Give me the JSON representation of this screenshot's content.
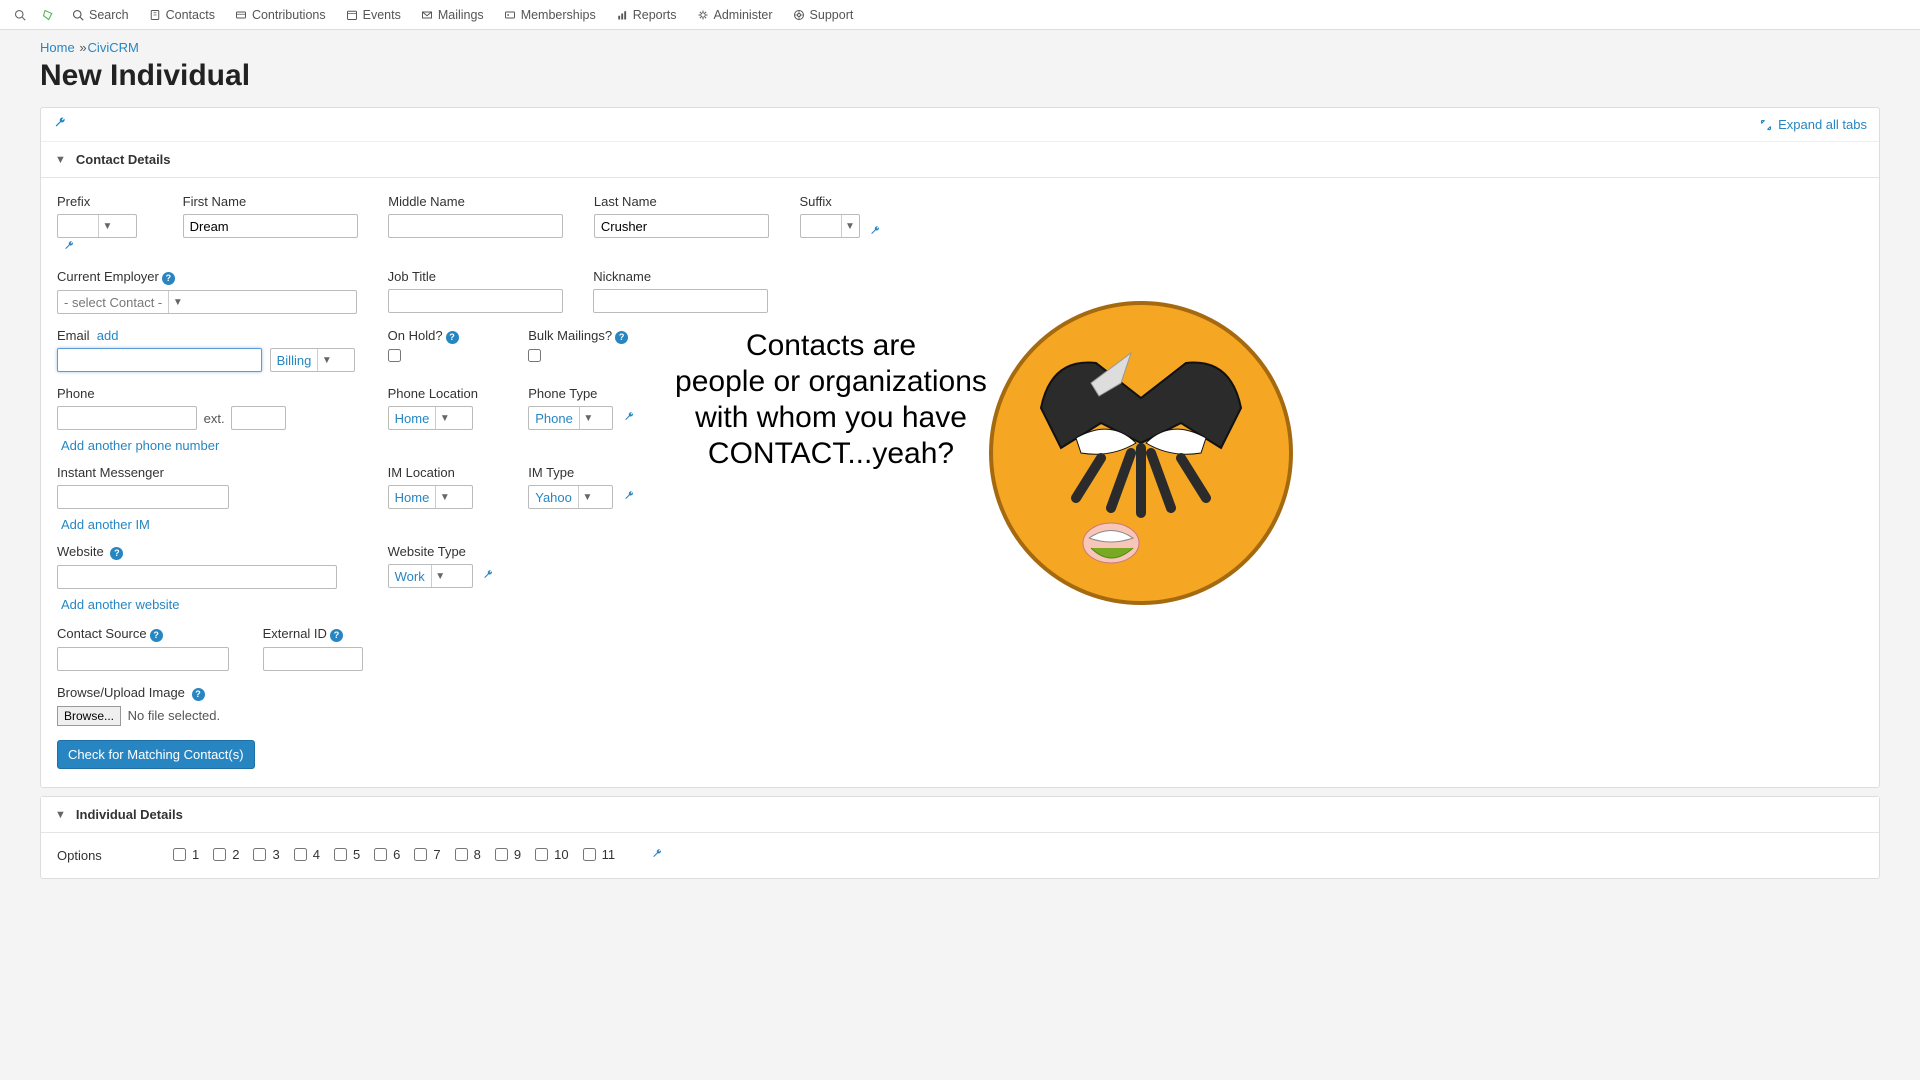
{
  "nav": {
    "search": "Search",
    "contacts": "Contacts",
    "contributions": "Contributions",
    "events": "Events",
    "mailings": "Mailings",
    "memberships": "Memberships",
    "reports": "Reports",
    "administer": "Administer",
    "support": "Support"
  },
  "breadcrumb": {
    "home": "Home",
    "civicrm": "CiviCRM"
  },
  "page_title": "New Individual",
  "expand_all": "Expand all tabs",
  "sections": {
    "contact_details": "Contact Details",
    "individual_details": "Individual Details"
  },
  "labels": {
    "prefix": "Prefix",
    "first_name": "First Name",
    "middle_name": "Middle Name",
    "last_name": "Last Name",
    "suffix": "Suffix",
    "current_employer": "Current Employer",
    "job_title": "Job Title",
    "nickname": "Nickname",
    "email": "Email",
    "add": "add",
    "on_hold": "On Hold?",
    "bulk_mailings": "Bulk Mailings?",
    "phone": "Phone",
    "ext": "ext.",
    "phone_location": "Phone Location",
    "phone_type": "Phone Type",
    "add_phone": "Add another phone number",
    "im": "Instant Messenger",
    "im_location": "IM Location",
    "im_type": "IM Type",
    "add_im": "Add another IM",
    "website": "Website",
    "website_type": "Website Type",
    "add_website": "Add another website",
    "contact_source": "Contact Source",
    "external_id": "External ID",
    "upload_image": "Browse/Upload Image",
    "browse": "Browse...",
    "no_file": "No file selected.",
    "check_matching": "Check for Matching Contact(s)",
    "options": "Options"
  },
  "values": {
    "first_name": "Dream",
    "last_name": "Crusher",
    "employer_placeholder": "- select Contact -",
    "email_type": "Billing",
    "phone_location": "Home",
    "phone_type": "Phone",
    "im_location": "Home",
    "im_type": "Yahoo",
    "website_type": "Work"
  },
  "options_numbers": [
    "1",
    "2",
    "3",
    "4",
    "5",
    "6",
    "7",
    "8",
    "9",
    "10",
    "11"
  ],
  "annotation": "Contacts are\npeople or organizations\nwith whom you have\nCONTACT...yeah?"
}
